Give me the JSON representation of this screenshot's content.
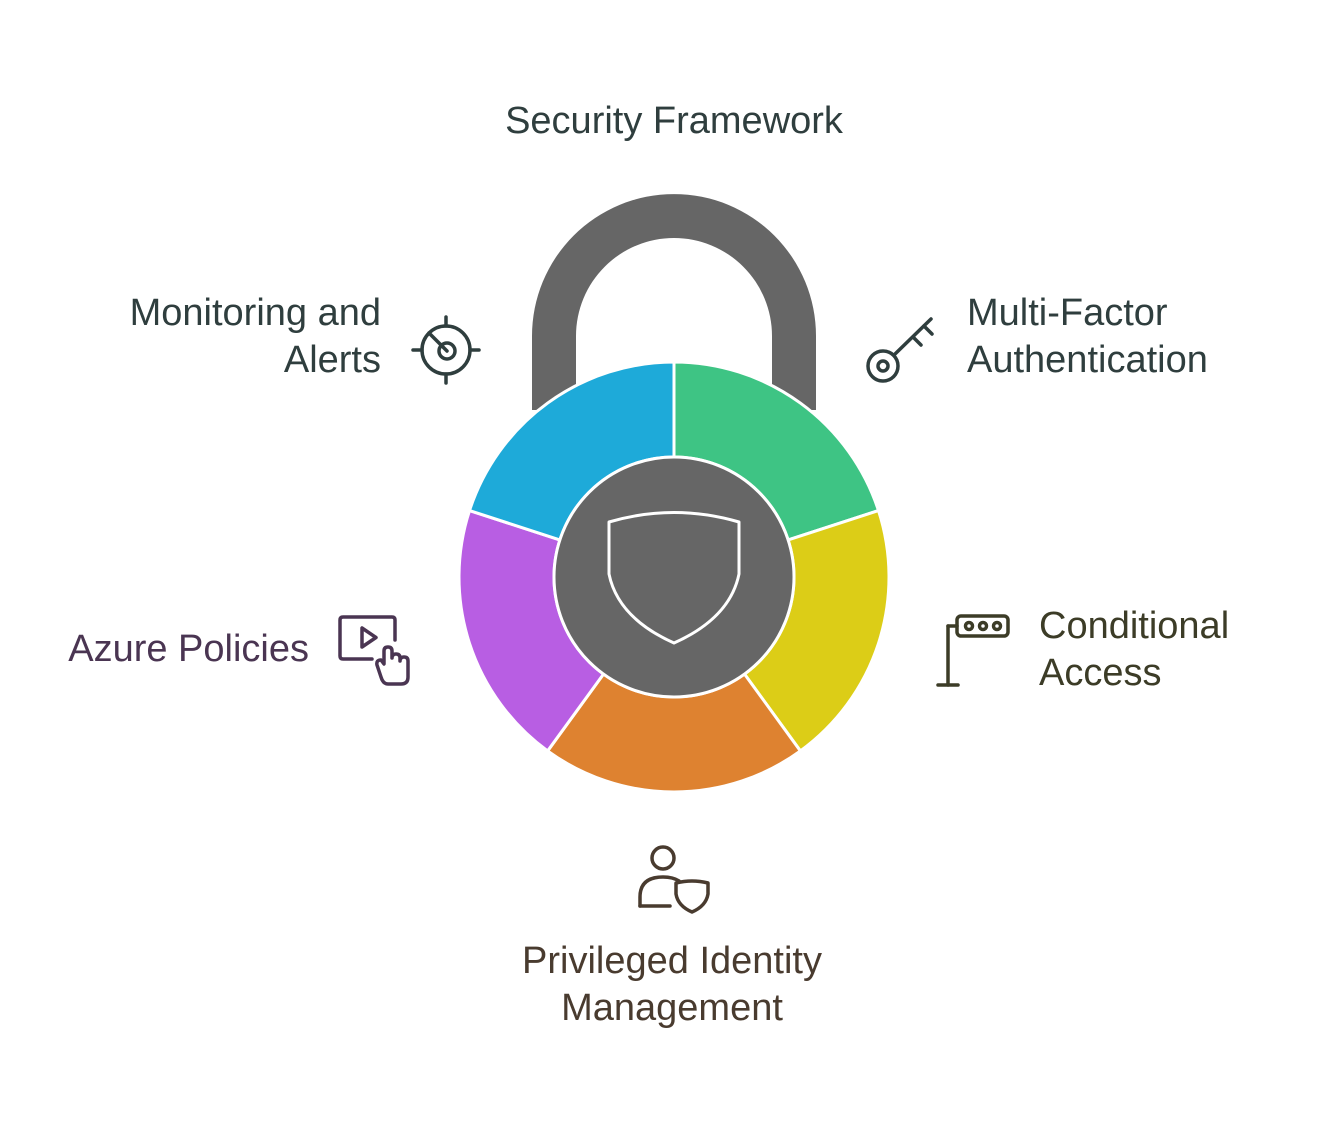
{
  "title": "Security Framework",
  "colors": {
    "lock_body": "#666666",
    "text_dark": "#2f3e3e",
    "segment_mfa": "#3ec484",
    "segment_conditional": "#dccd17",
    "segment_pim": "#de8230",
    "segment_azure": "#b85ee3",
    "segment_monitoring": "#1eaad9"
  },
  "segments": {
    "monitoring": {
      "lines": [
        "Monitoring and",
        "Alerts"
      ],
      "icon": "radar-icon",
      "color": "#1eaad9",
      "text_color": "#2f3e3e"
    },
    "mfa": {
      "lines": [
        "Multi-Factor",
        "Authentication"
      ],
      "icon": "key-icon",
      "color": "#3ec484",
      "text_color": "#2f3e3e"
    },
    "conditional": {
      "lines": [
        "Conditional",
        "Access"
      ],
      "icon": "barrier-gate-icon",
      "color": "#dccd17",
      "text_color": "#3c3c27"
    },
    "pim": {
      "lines": [
        "Privileged Identity",
        "Management"
      ],
      "icon": "user-shield-icon",
      "color": "#de8230",
      "text_color": "#493b2f"
    },
    "azure": {
      "lines": [
        "Azure Policies"
      ],
      "icon": "video-touch-icon",
      "color": "#b85ee3",
      "text_color": "#4a3552"
    }
  },
  "center_icon": "shield-icon"
}
